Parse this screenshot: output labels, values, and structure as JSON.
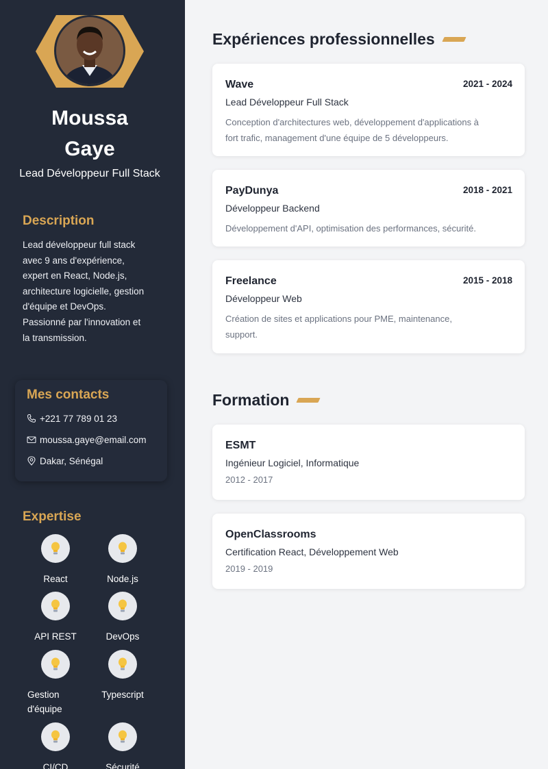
{
  "profile": {
    "first_name": "Moussa",
    "last_name": "Gaye",
    "role": "Lead Développeur Full Stack"
  },
  "description": {
    "heading": "Description",
    "lines": [
      "Lead développeur full stack",
      "avec 9 ans d'expérience,",
      "expert en React, Node.js,",
      "architecture logicielle, gestion",
      "d'équipe et DevOps.",
      "Passionné par l'innovation et",
      "la transmission."
    ]
  },
  "contacts": {
    "heading": "Mes contacts",
    "phone": "+221 77 789 01 23",
    "email": "moussa.gaye@email.com",
    "location": "Dakar, Sénégal"
  },
  "expertise": {
    "heading": "Expertise",
    "skills": [
      {
        "line1": "React",
        "line2": ""
      },
      {
        "line1": "Node.js",
        "line2": ""
      },
      {
        "line1": "API REST",
        "line2": ""
      },
      {
        "line1": "DevOps",
        "line2": ""
      },
      {
        "line1": "Gestion",
        "line2": "d'équipe"
      },
      {
        "line1": "Typescript",
        "line2": ""
      },
      {
        "line1": "CI/CD",
        "line2": ""
      },
      {
        "line1": "Sécurité",
        "line2": ""
      }
    ]
  },
  "experiences": {
    "heading": "Expériences professionnelles",
    "items": [
      {
        "company": "Wave",
        "dates": "2021 - 2024",
        "role": "Lead Développeur Full Stack",
        "desc1": "Conception d'architectures web, développement d'applications à",
        "desc2": "fort trafic, management d'une équipe de 5 développeurs."
      },
      {
        "company": "PayDunya",
        "dates": "2018 - 2021",
        "role": "Développeur Backend",
        "desc1": "Développement d'API, optimisation des performances, sécurité.",
        "desc2": ""
      },
      {
        "company": "Freelance",
        "dates": "2015 - 2018",
        "role": "Développeur Web",
        "desc1": "Création de sites et applications pour PME, maintenance,",
        "desc2": "support."
      }
    ]
  },
  "education": {
    "heading": "Formation",
    "items": [
      {
        "school": "ESMT",
        "degree": "Ingénieur Logiciel, Informatique",
        "years": "2012 - 2017"
      },
      {
        "school": "OpenClassrooms",
        "degree": "Certification React, Développement Web",
        "years": "2019 - 2019"
      }
    ]
  },
  "colors": {
    "sidebar": "#232a38",
    "accent": "#d9a654",
    "page": "#f3f4f6"
  }
}
